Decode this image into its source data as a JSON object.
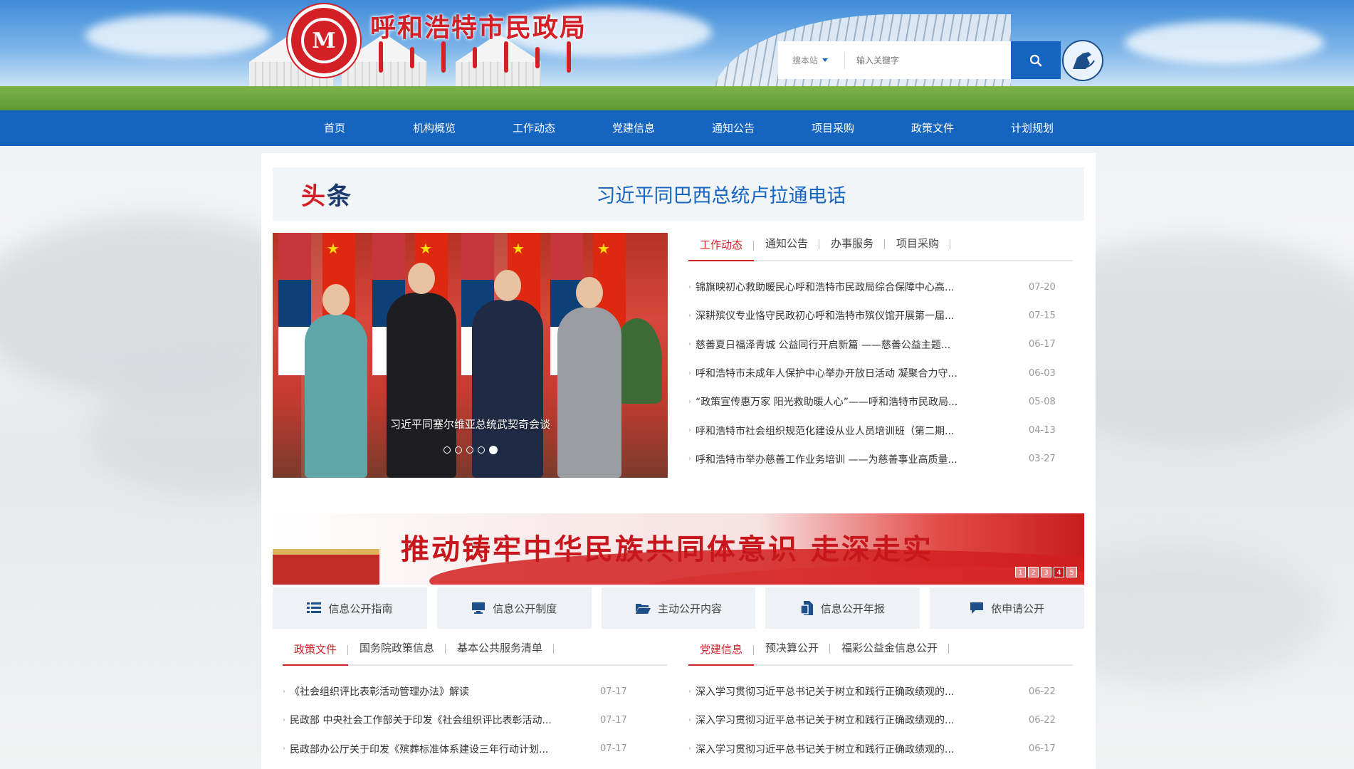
{
  "header": {
    "site_title": "呼和浩特市民政局",
    "logo_glyph": "M",
    "search": {
      "scope": "搜本站",
      "placeholder": "输入关键字"
    }
  },
  "nav": {
    "items": [
      "首页",
      "机构概览",
      "工作动态",
      "党建信息",
      "通知公告",
      "项目采购",
      "政策文件",
      "计划规划"
    ]
  },
  "headline": {
    "tag_first": "头",
    "tag_rest": "条",
    "title": "习近平同巴西总统卢拉通电话"
  },
  "carousel": {
    "caption": "习近平同塞尔维亚总统武契奇会谈",
    "slides": 5,
    "active_slide": 5
  },
  "news_tabs": {
    "tabs": [
      "工作动态",
      "通知公告",
      "办事服务",
      "项目采购"
    ],
    "active": 0,
    "items": [
      {
        "title": "锦旗映初心救助暖民心呼和浩特市民政局综合保障中心高...",
        "date": "07-20"
      },
      {
        "title": "深耕殡仪专业恪守民政初心呼和浩特市殡仪馆开展第一届...",
        "date": "07-15"
      },
      {
        "title": "慈善夏日福泽青城 公益同行开启新篇 ——慈善公益主题...",
        "date": "06-17"
      },
      {
        "title": "呼和浩特市未成年人保护中心举办开放日活动 凝聚合力守...",
        "date": "06-03"
      },
      {
        "title": "“政策宣传惠万家 阳光救助暖人心”——呼和浩特市民政局...",
        "date": "05-08"
      },
      {
        "title": "呼和浩特市社会组织规范化建设从业人员培训班（第二期...",
        "date": "04-13"
      },
      {
        "title": "呼和浩特市举办慈善工作业务培训 ——为慈善事业高质量...",
        "date": "03-27"
      }
    ]
  },
  "banner": {
    "text": "推动铸牢中华民族共同体意识 走深走实",
    "pages": [
      "1",
      "2",
      "3",
      "4",
      "5"
    ],
    "active_page": 3
  },
  "quick_links": [
    {
      "label": "信息公开指南",
      "icon": "list-icon"
    },
    {
      "label": "信息公开制度",
      "icon": "monitor-icon"
    },
    {
      "label": "主动公开内容",
      "icon": "folder-open-icon"
    },
    {
      "label": "信息公开年报",
      "icon": "document-icon"
    },
    {
      "label": "依申请公开",
      "icon": "comment-icon"
    }
  ],
  "policy_tabs": {
    "tabs": [
      "政策文件",
      "国务院政策信息",
      "基本公共服务清单"
    ],
    "active": 0,
    "items": [
      {
        "title": "《社会组织评比表彰活动管理办法》解读",
        "date": "07-17"
      },
      {
        "title": "民政部 中央社会工作部关于印发《社会组织评比表彰活动...",
        "date": "07-17"
      },
      {
        "title": "民政部办公厅关于印发《殡葬标准体系建设三年行动计划...",
        "date": "07-17"
      }
    ]
  },
  "party_tabs": {
    "tabs": [
      "党建信息",
      "预决算公开",
      "福彩公益金信息公开"
    ],
    "active": 0,
    "items": [
      {
        "title": "深入学习贯彻习近平总书记关于树立和践行正确政绩观的...",
        "date": "06-22"
      },
      {
        "title": "深入学习贯彻习近平总书记关于树立和践行正确政绩观的...",
        "date": "06-22"
      },
      {
        "title": "深入学习贯彻习近平总书记关于树立和践行正确政绩观的...",
        "date": "06-17"
      }
    ]
  },
  "colors": {
    "brand_red": "#d41f26",
    "nav_blue": "#1565c0"
  }
}
